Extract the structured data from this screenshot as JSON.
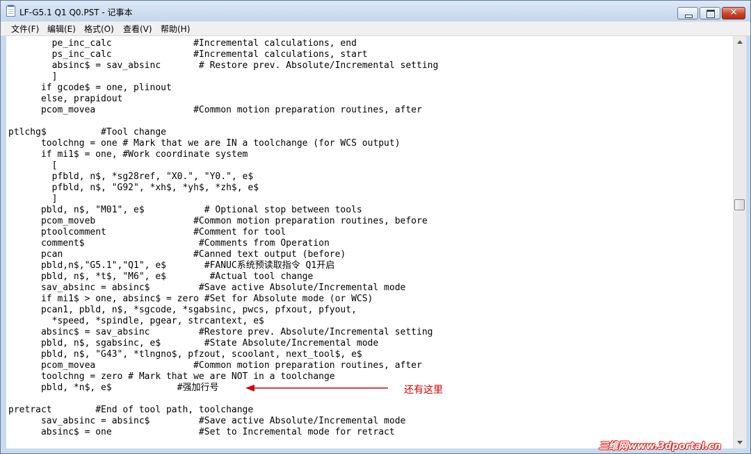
{
  "window": {
    "title": "LF-G5.1 Q1 Q0.PST - 记事本"
  },
  "titlebar_buttons": {
    "minimize": "minimize-icon",
    "maximize": "maximize-icon",
    "close": "close-icon",
    "close_glyph": "✕"
  },
  "menu": [
    "文件(F)",
    "编辑(E)",
    "格式(O)",
    "查看(V)",
    "帮助(H)"
  ],
  "editor": {
    "lines": [
      "        pe_inc_calc               #Incremental calculations, end",
      "        ps_inc_calc               #Incremental calculations, start",
      "        absinc$ = sav_absinc       # Restore prev. Absolute/Incremental setting",
      "        ]",
      "      if gcode$ = one, plinout",
      "      else, prapidout",
      "      pcom_movea                  #Common motion preparation routines, after",
      "",
      "ptlchg$          #Tool change",
      "      toolchng = one # Mark that we are IN a toolchange (for WCS output)",
      "      if mi1$ = one, #Work coordinate system",
      "        [",
      "        pfbld, n$, *sg28ref, \"X0.\", \"Y0.\", e$",
      "        pfbld, n$, \"G92\", *xh$, *yh$, *zh$, e$",
      "        ]",
      "      pbld, n$, \"M01\", e$           # Optional stop between tools",
      "      pcom_moveb                  #Common motion preparation routines, before",
      "      ptoolcomment                #Comment for tool",
      "      comment$                     #Comments from Operation",
      "      pcan                        #Canned text output (before)",
      "      pbld,n$,\"G5.1\",\"Q1\", e$       #FANUC系统预读取指令 Q1开启",
      "      pbld, n$, *t$, \"M6\", e$        #Actual tool change",
      "      sav_absinc = absinc$         #Save active Absolute/Incremental mode",
      "      if mi1$ > one, absinc$ = zero #Set for Absolute mode (or WCS)",
      "      pcan1, pbld, n$, *sgcode, *sgabsinc, pwcs, pfxout, pfyout,",
      "        *speed, *spindle, pgear, strcantext, e$",
      "      absinc$ = sav_absinc         #Restore prev. Absolute/Incremental setting",
      "      pbld, n$, sgabsinc, e$        #State Absolute/Incremental mode",
      "      pbld, n$, \"G43\", *tlngno$, pfzout, scoolant, next_tool$, e$",
      "      pcom_movea                  #Common motion preparation routines, after",
      "      toolchng = zero # Mark that we are NOT in a toolchange",
      "      pbld, *n$, e$            #强加行号",
      "",
      "pretract        #End of tool path, toolchange",
      "      sav_absinc = absinc$         #Save active Absolute/Incremental mode",
      "      absinc$ = one                #Set to Incremental mode for retract"
    ]
  },
  "annotation": {
    "text": "还有这里",
    "color": "#d10000"
  },
  "watermark": {
    "text": "三维网www.3dportal.cn",
    "color": "#e2231a"
  }
}
